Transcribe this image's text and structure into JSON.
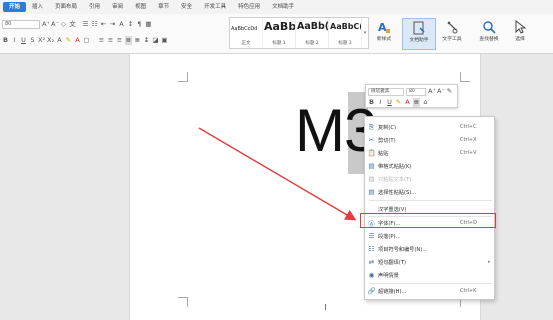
{
  "tabs": [
    "开始",
    "插入",
    "页面布局",
    "引用",
    "审阅",
    "视图",
    "章节",
    "安全",
    "开发工具",
    "特色应用",
    "文档助手"
  ],
  "ribbon": {
    "font_size": "80",
    "styles": [
      {
        "sample": "AaBbCcDd",
        "caption": "正文"
      },
      {
        "sample": "AaBb",
        "caption": "标题 1"
      },
      {
        "sample": "AaBb(",
        "caption": "标题 2"
      },
      {
        "sample": "AaBbC(",
        "caption": "标题 3"
      }
    ],
    "new_style": "新样式",
    "doc_assistant": "文档助手",
    "text_tools": "文字工具",
    "find_replace": "查找替换",
    "select": "选择"
  },
  "document": {
    "text": "M3"
  },
  "mini_toolbar": {
    "font_name": "微软雅黑",
    "font_size": "80"
  },
  "context_menu": {
    "items": [
      {
        "label": "复制(C)",
        "key": "Ctrl+C",
        "icon": "copy-icon",
        "glyph": "⎘",
        "disabled": false
      },
      {
        "label": "剪切(T)",
        "key": "Ctrl+X",
        "icon": "scissors-icon",
        "glyph": "✂",
        "disabled": false
      },
      {
        "label": "粘贴",
        "key": "Ctrl+V",
        "icon": "paste-icon",
        "glyph": "📋",
        "disabled": false
      },
      {
        "label": "带格式粘贴(K)",
        "key": "",
        "icon": "paste-format-icon",
        "glyph": "▤",
        "disabled": false
      },
      {
        "label": "只粘贴文本(T)",
        "key": "",
        "icon": "paste-text-icon",
        "glyph": "▤",
        "disabled": true
      },
      {
        "label": "选择性粘贴(S)...",
        "key": "",
        "icon": "paste-special-icon",
        "glyph": "▤",
        "disabled": false
      },
      {
        "label": "汉字重选(V)",
        "key": "",
        "icon": "",
        "glyph": "",
        "disabled": false
      },
      {
        "label": "字体(F)...",
        "key": "Ctrl+D",
        "icon": "font-icon",
        "glyph": "Ⓐ",
        "disabled": false
      },
      {
        "label": "段落(P)...",
        "key": "",
        "icon": "paragraph-icon",
        "glyph": "☰",
        "disabled": false
      },
      {
        "label": "项目符号和编号(N)...",
        "key": "",
        "icon": "bullets-icon",
        "glyph": "☷",
        "disabled": false
      },
      {
        "label": "短句翻译(T)",
        "key": "",
        "icon": "translate-icon",
        "glyph": "⇄",
        "disabled": false
      },
      {
        "label": "声明情景",
        "key": "",
        "icon": "scene-icon",
        "glyph": "◉",
        "disabled": false
      },
      {
        "label": "超链接(H)...",
        "key": "Ctrl+K",
        "icon": "link-icon",
        "glyph": "🔗",
        "disabled": false
      }
    ]
  }
}
